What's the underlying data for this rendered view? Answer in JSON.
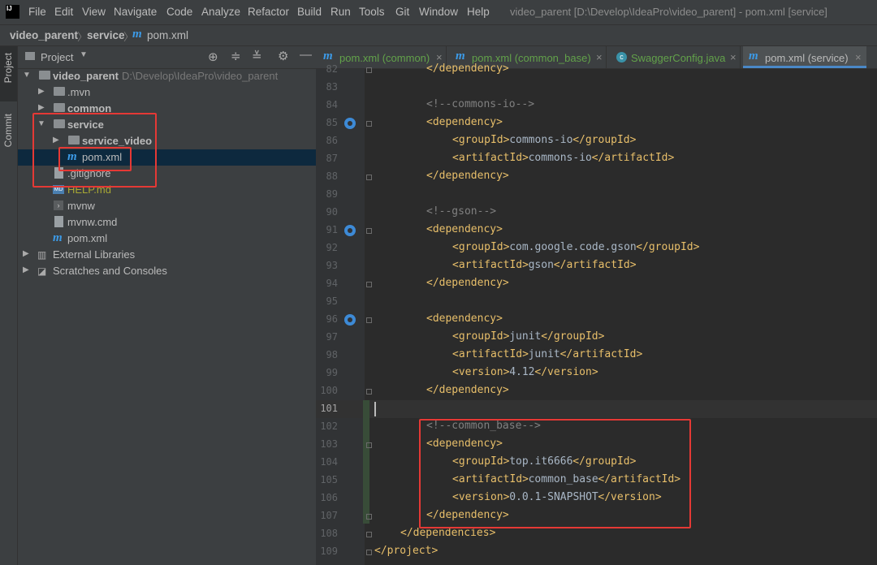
{
  "app": {
    "logo_text": "IJ",
    "menu": [
      "File",
      "Edit",
      "View",
      "Navigate",
      "Code",
      "Analyze",
      "Refactor",
      "Build",
      "Run",
      "Tools",
      "Git",
      "Window",
      "Help"
    ],
    "window_title": "video_parent [D:\\Develop\\IdeaPro\\video_parent] - pom.xml [service]"
  },
  "breadcrumb": [
    "video_parent",
    "service",
    "pom.xml"
  ],
  "toolstrip": {
    "project": "Project",
    "commit": "Commit"
  },
  "project_panel": {
    "title": "Project",
    "tree": [
      {
        "label": "video_parent",
        "path": "D:\\Develop\\IdeaPro\\video_parent",
        "icon": "module-folder-icon"
      },
      {
        "label": ".mvn",
        "icon": "folder-icon"
      },
      {
        "label": "common",
        "icon": "module-folder-icon"
      },
      {
        "label": "service",
        "icon": "module-folder-icon"
      },
      {
        "label": "service_video",
        "icon": "module-folder-icon"
      },
      {
        "label": "pom.xml",
        "icon": "maven-icon"
      },
      {
        "label": ".gitignore",
        "icon": "gitignore-icon"
      },
      {
        "label": "HELP.md",
        "icon": "markdown-icon"
      },
      {
        "label": "mvnw",
        "icon": "script-icon"
      },
      {
        "label": "mvnw.cmd",
        "icon": "text-file-icon"
      },
      {
        "label": "pom.xml",
        "icon": "maven-icon"
      },
      {
        "label": "External Libraries",
        "icon": "library-icon"
      },
      {
        "label": "Scratches and Consoles",
        "icon": "scratch-icon"
      }
    ]
  },
  "editor": {
    "tabs": [
      {
        "label": "pom.xml (common)",
        "active": false
      },
      {
        "label": "pom.xml (common_base)",
        "active": false
      },
      {
        "label": "SwaggerConfig.java",
        "active": false
      },
      {
        "label": "pom.xml (service)",
        "active": true
      }
    ],
    "current_line": "101",
    "lines": [
      {
        "n": "82",
        "indent": 2,
        "parts": [
          [
            "tag",
            "</dependency>"
          ]
        ]
      },
      {
        "n": "83",
        "indent": 0,
        "parts": []
      },
      {
        "n": "84",
        "indent": 2,
        "parts": [
          [
            "cmt",
            "<!--commons-io-->"
          ]
        ]
      },
      {
        "n": "85",
        "indent": 2,
        "parts": [
          [
            "tag",
            "<dependency>"
          ]
        ]
      },
      {
        "n": "86",
        "indent": 3,
        "parts": [
          [
            "tag",
            "<groupId>"
          ],
          [
            "txt",
            "commons-io"
          ],
          [
            "tag",
            "</groupId>"
          ]
        ]
      },
      {
        "n": "87",
        "indent": 3,
        "parts": [
          [
            "tag",
            "<artifactId>"
          ],
          [
            "txt",
            "commons-io"
          ],
          [
            "tag",
            "</artifactId>"
          ]
        ]
      },
      {
        "n": "88",
        "indent": 2,
        "parts": [
          [
            "tag",
            "</dependency>"
          ]
        ]
      },
      {
        "n": "89",
        "indent": 0,
        "parts": []
      },
      {
        "n": "90",
        "indent": 2,
        "parts": [
          [
            "cmt",
            "<!--gson-->"
          ]
        ]
      },
      {
        "n": "91",
        "indent": 2,
        "parts": [
          [
            "tag",
            "<dependency>"
          ]
        ]
      },
      {
        "n": "92",
        "indent": 3,
        "parts": [
          [
            "tag",
            "<groupId>"
          ],
          [
            "txt",
            "com.google.code.gson"
          ],
          [
            "tag",
            "</groupId>"
          ]
        ]
      },
      {
        "n": "93",
        "indent": 3,
        "parts": [
          [
            "tag",
            "<artifactId>"
          ],
          [
            "txt",
            "gson"
          ],
          [
            "tag",
            "</artifactId>"
          ]
        ]
      },
      {
        "n": "94",
        "indent": 2,
        "parts": [
          [
            "tag",
            "</dependency>"
          ]
        ]
      },
      {
        "n": "95",
        "indent": 0,
        "parts": []
      },
      {
        "n": "96",
        "indent": 2,
        "parts": [
          [
            "tag",
            "<dependency>"
          ]
        ]
      },
      {
        "n": "97",
        "indent": 3,
        "parts": [
          [
            "tag",
            "<groupId>"
          ],
          [
            "txt",
            "junit"
          ],
          [
            "tag",
            "</groupId>"
          ]
        ]
      },
      {
        "n": "98",
        "indent": 3,
        "parts": [
          [
            "tag",
            "<artifactId>"
          ],
          [
            "txt",
            "junit"
          ],
          [
            "tag",
            "</artifactId>"
          ]
        ]
      },
      {
        "n": "99",
        "indent": 3,
        "parts": [
          [
            "tag",
            "<version>"
          ],
          [
            "txt",
            "4.12"
          ],
          [
            "tag",
            "</version>"
          ]
        ]
      },
      {
        "n": "100",
        "indent": 2,
        "parts": [
          [
            "tag",
            "</dependency>"
          ]
        ]
      },
      {
        "n": "101",
        "indent": 0,
        "parts": []
      },
      {
        "n": "102",
        "indent": 2,
        "parts": [
          [
            "cmt",
            "<!--common_base-->"
          ]
        ]
      },
      {
        "n": "103",
        "indent": 2,
        "parts": [
          [
            "tag",
            "<dependency>"
          ]
        ]
      },
      {
        "n": "104",
        "indent": 3,
        "parts": [
          [
            "tag",
            "<groupId>"
          ],
          [
            "txt",
            "top.it6666"
          ],
          [
            "tag",
            "</groupId>"
          ]
        ]
      },
      {
        "n": "105",
        "indent": 3,
        "parts": [
          [
            "tag",
            "<artifactId>"
          ],
          [
            "txt",
            "common_base"
          ],
          [
            "tag",
            "</artifactId>"
          ]
        ]
      },
      {
        "n": "106",
        "indent": 3,
        "parts": [
          [
            "tag",
            "<version>"
          ],
          [
            "txt",
            "0.0.1-SNAPSHOT"
          ],
          [
            "tag",
            "</version>"
          ]
        ]
      },
      {
        "n": "107",
        "indent": 2,
        "parts": [
          [
            "tag",
            "</dependency>"
          ]
        ]
      },
      {
        "n": "108",
        "indent": 1,
        "parts": [
          [
            "tag",
            "</dependencies>"
          ]
        ]
      },
      {
        "n": "109",
        "indent": 0,
        "parts": [
          [
            "tag",
            "</project>"
          ]
        ]
      }
    ]
  },
  "colors": {
    "highlight_box": "#e53935",
    "tag": "#e8bf6a",
    "comment": "#808080",
    "text": "#a9b7c6",
    "accent": "#4a88c7"
  }
}
